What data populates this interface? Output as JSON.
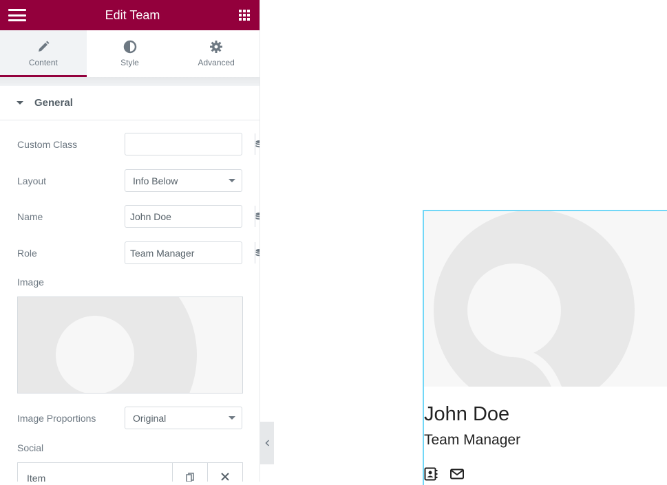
{
  "header": {
    "title": "Edit Team",
    "menu_icon": "hamburger-icon",
    "apps_icon": "grid-icon"
  },
  "tabs": [
    {
      "label": "Content",
      "icon": "pencil-icon",
      "active": true
    },
    {
      "label": "Style",
      "icon": "contrast-icon",
      "active": false
    },
    {
      "label": "Advanced",
      "icon": "gear-icon",
      "active": false
    }
  ],
  "section": {
    "title": "General",
    "expanded": true
  },
  "fields": {
    "custom_class": {
      "label": "Custom Class",
      "value": "",
      "placeholder": ""
    },
    "layout": {
      "label": "Layout",
      "value": "Info Below"
    },
    "name": {
      "label": "Name",
      "value": "John Doe"
    },
    "role": {
      "label": "Role",
      "value": "Team Manager"
    },
    "image": {
      "label": "Image"
    },
    "image_proportions": {
      "label": "Image Proportions",
      "value": "Original"
    },
    "social": {
      "label": "Social",
      "items": [
        {
          "title": "Item"
        }
      ]
    }
  },
  "preview": {
    "name": "John Doe",
    "role": "Team Manager",
    "social_icons": [
      "address-book-icon",
      "envelope-icon"
    ]
  },
  "colors": {
    "brand": "#93003c",
    "selection": "#71d7f7"
  }
}
